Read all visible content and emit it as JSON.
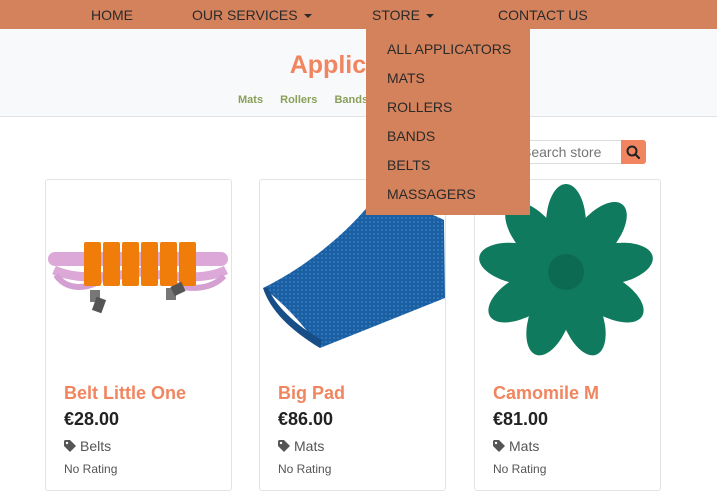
{
  "nav": {
    "home": "HOME",
    "services": "OUR SERVICES",
    "store": "STORE",
    "contact": "CONTACT US"
  },
  "header": {
    "title": "Applicators",
    "links": [
      "Mats",
      "Rollers",
      "Bands"
    ]
  },
  "search": {
    "placeholder": "Search store"
  },
  "dropdown": {
    "items": [
      "ALL APPLICATORS",
      "MATS",
      "ROLLERS",
      "BANDS",
      "BELTS",
      "MASSAGERS"
    ]
  },
  "products": [
    {
      "name": "Belt Little One",
      "price": "€28.00",
      "category": "Belts",
      "rating": "No Rating"
    },
    {
      "name": "Big Pad",
      "price": "€86.00",
      "category": "Mats",
      "rating": "No Rating"
    },
    {
      "name": "Camomile M",
      "price": "€81.00",
      "category": "Mats",
      "rating": "No Rating"
    }
  ],
  "colors": {
    "nav_bg": "#d4825c",
    "accent": "#f0855f",
    "sub_link": "#8aa05a"
  }
}
